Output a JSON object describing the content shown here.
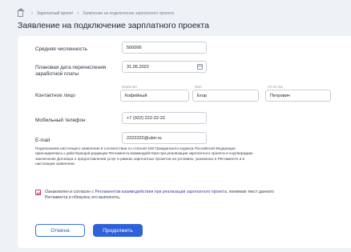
{
  "breadcrumb": {
    "items": [
      "Зарплатный проект",
      "Заявление на подключение зарплатного проекта"
    ]
  },
  "page": {
    "title": "Заявление на подключение зарплатного проекта"
  },
  "form": {
    "headcount": {
      "label": "Средняя численность",
      "value": "500000"
    },
    "transfer_date": {
      "label": "Плановая дата перечисления заработной платы",
      "value": "31.05.2022"
    },
    "contact": {
      "label": "Контактное лицо",
      "surname": {
        "caption": "Фамилия",
        "value": "Кофейный"
      },
      "name": {
        "caption": "Имя",
        "value": "Егор"
      },
      "patronymic": {
        "caption": "Отчество",
        "value": "Петрович"
      }
    },
    "phone": {
      "label": "Мобильный телефон",
      "value": "+7 (922) 222-22-22"
    },
    "email": {
      "label": "E-mail",
      "value": "2222222@ubrr.ru"
    }
  },
  "note": "Подписанием настоящего заявления в соответствии со статьей 428 Гражданского кодекса Российской Федерации присоединяюсь к действующей редакции Регламента взаимодействия при реализации зарплатного проекта и подтверждаю заключение Договора о предоставлении услуг в рамках зарплатных проектов на условиях, указанных в Регламенте и в настоящем заявлении.",
  "agreement": {
    "checked": true,
    "prefix": "Ознакомлен и согласен с ",
    "link": "Регламентом взаимодействия при реализации зарплатного проекта",
    "suffix": ", понимаю текст данного Регламента и обязуюсь его выполнять."
  },
  "buttons": {
    "cancel": "Отмена",
    "next": "Продолжить"
  },
  "colors": {
    "accent": "#2f62d8",
    "checkbox": "#c43a5a",
    "link": "#3b3fa8"
  }
}
